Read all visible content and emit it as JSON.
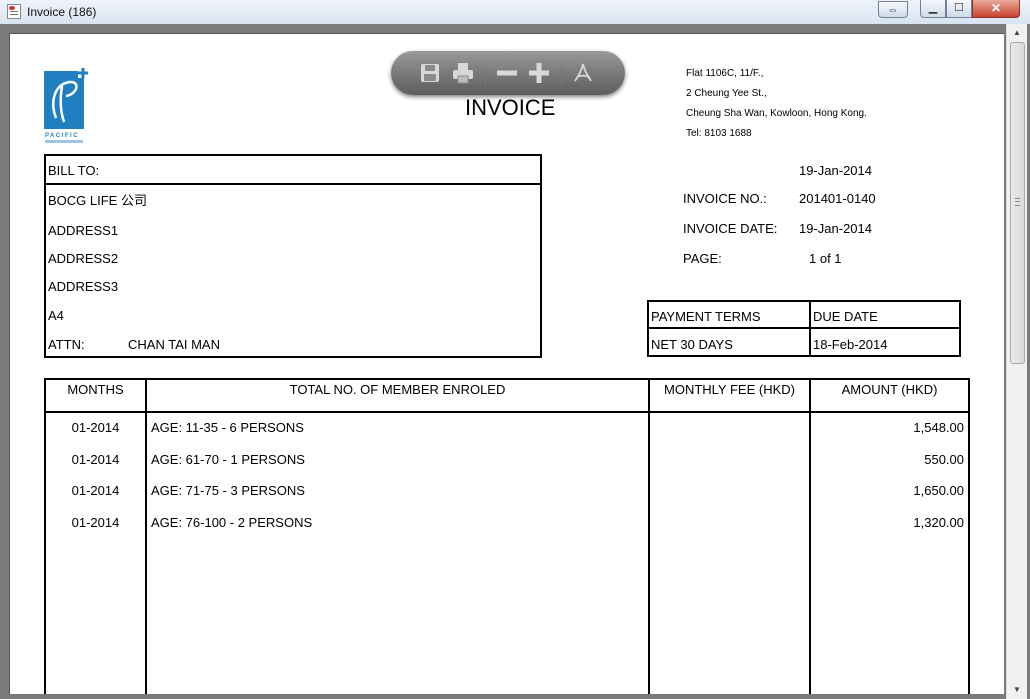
{
  "window": {
    "title": "Invoice (186)"
  },
  "company": {
    "address_lines": [
      "Flat 1106C, 11/F.,",
      "2 Cheung Yee St.,",
      "Cheung Sha Wan, Kowloon, Hong Kong.",
      "Tel: 8103 1688"
    ]
  },
  "invoice": {
    "title": "INVOICE",
    "date_top": "19-Jan-2014",
    "no_label": "INVOICE NO.:",
    "no_value": "201401-0140",
    "date_label": "INVOICE DATE:",
    "date_value": "19-Jan-2014",
    "page_label": "PAGE:",
    "page_value": "1 of  1"
  },
  "bill_to": {
    "label": "BILL TO:",
    "name": "BOCG LIFE 公司",
    "address1": "ADDRESS1",
    "address2": "ADDRESS2",
    "address3": "ADDRESS3",
    "address4": "A4",
    "attn_label": "ATTN:",
    "attn_value": "CHAN TAI MAN"
  },
  "terms": {
    "payment_terms_label": "PAYMENT TERMS",
    "due_date_label": "DUE DATE",
    "payment_terms_value": "NET 30 DAYS",
    "due_date_value": "18-Feb-2014"
  },
  "table": {
    "headers": [
      "MONTHS",
      "TOTAL NO. OF MEMBER ENROLED",
      "MONTHLY FEE (HKD)",
      "AMOUNT (HKD)"
    ],
    "rows": [
      {
        "month": "01-2014",
        "desc": "AGE: 11-35 - 6 PERSONS",
        "fee": "",
        "amount": "1,548.00"
      },
      {
        "month": "01-2014",
        "desc": "AGE: 61-70 - 1 PERSONS",
        "fee": "",
        "amount": "550.00"
      },
      {
        "month": "01-2014",
        "desc": "AGE: 71-75 - 3 PERSONS",
        "fee": "",
        "amount": "1,650.00"
      },
      {
        "month": "01-2014",
        "desc": "AGE: 76-100 - 2 PERSONS",
        "fee": "",
        "amount": "1,320.00"
      }
    ]
  },
  "colors": {
    "logo_blue": "#1f7fc0",
    "titlebar": "#dde7f3",
    "close_red": "#c8442d"
  }
}
